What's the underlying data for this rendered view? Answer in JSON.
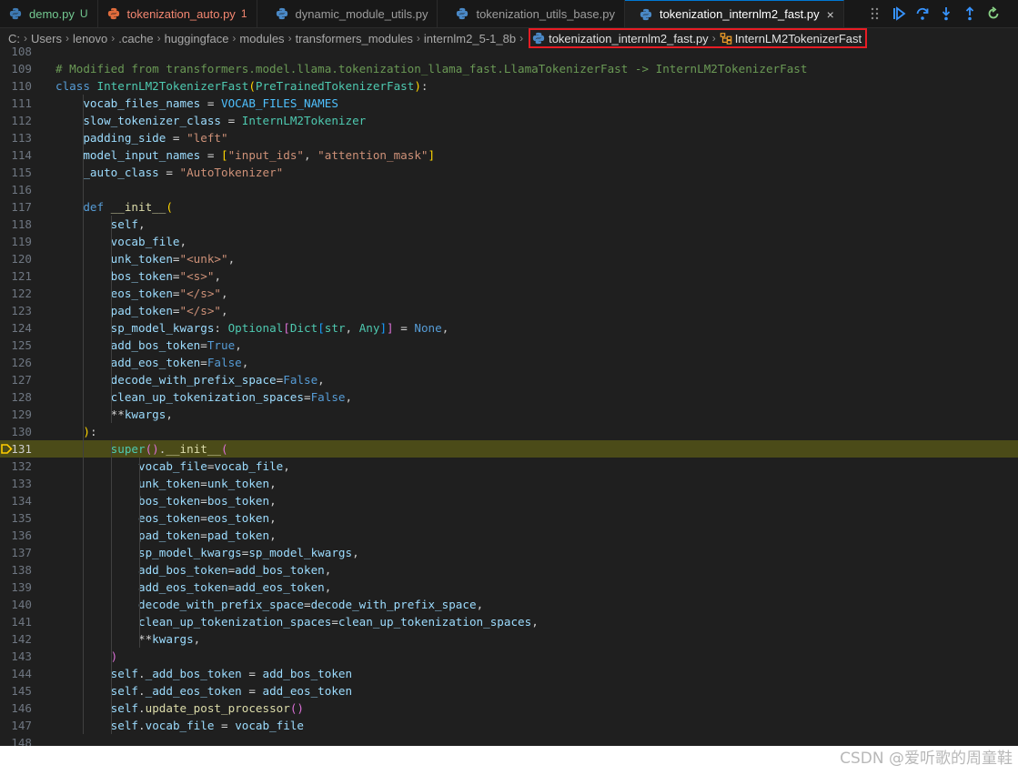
{
  "tabs": [
    {
      "label": "demo.py",
      "badge": "U",
      "state": "modified"
    },
    {
      "label": "tokenization_auto.py",
      "badge": "1",
      "state": "error"
    },
    {
      "label": "dynamic_module_utils.py",
      "badge": "",
      "state": "normal"
    },
    {
      "label": "tokenization_utils_base.py",
      "badge": "",
      "state": "normal"
    },
    {
      "label": "tokenization_internlm2_fast.py",
      "badge": "",
      "state": "active"
    }
  ],
  "tab_close_glyph": "×",
  "debug_toolbar": [
    {
      "name": "drag-handle-icon"
    },
    {
      "name": "continue-icon"
    },
    {
      "name": "step-over-icon"
    },
    {
      "name": "step-into-icon"
    },
    {
      "name": "step-out-icon"
    },
    {
      "name": "restart-icon"
    }
  ],
  "breadcrumb": {
    "path": [
      "C:",
      "Users",
      "lenovo",
      ".cache",
      "huggingface",
      "modules",
      "transformers_modules",
      "internlm2_5-1_8b"
    ],
    "file": "tokenization_internlm2_fast.py",
    "symbol": "InternLM2TokenizerFast",
    "separator": "›"
  },
  "colors": {
    "editor_bg": "#1f1f1f",
    "current_line": "#4b4b18",
    "highlight_box": "#e81c24",
    "comment": "#6a9955",
    "keyword": "#569cd6",
    "class": "#4ec9b0",
    "variable": "#9cdcfe",
    "string": "#ce9178"
  },
  "current_line": 131,
  "code_lines": [
    {
      "n": 108,
      "tokens": []
    },
    {
      "n": 109,
      "tokens": [
        [
          "com",
          "# Modified from transformers.model.llama.tokenization_llama_fast.LlamaTokenizerFast -> InternLM2TokenizerFast"
        ]
      ]
    },
    {
      "n": 110,
      "tokens": [
        [
          "kw",
          "class"
        ],
        [
          "def",
          " "
        ],
        [
          "cls",
          "InternLM2TokenizerFast"
        ],
        [
          "p1",
          "("
        ],
        [
          "cls",
          "PreTrainedTokenizerFast"
        ],
        [
          "p1",
          ")"
        ],
        [
          "def",
          ":"
        ]
      ]
    },
    {
      "n": 111,
      "tokens": [
        [
          "def",
          "    "
        ],
        [
          "var",
          "vocab_files_names"
        ],
        [
          "op",
          " = "
        ],
        [
          "con",
          "VOCAB_FILES_NAMES"
        ]
      ]
    },
    {
      "n": 112,
      "tokens": [
        [
          "def",
          "    "
        ],
        [
          "var",
          "slow_tokenizer_class"
        ],
        [
          "op",
          " = "
        ],
        [
          "cls",
          "InternLM2Tokenizer"
        ]
      ]
    },
    {
      "n": 113,
      "tokens": [
        [
          "def",
          "    "
        ],
        [
          "var",
          "padding_side"
        ],
        [
          "op",
          " = "
        ],
        [
          "str",
          "\"left\""
        ]
      ]
    },
    {
      "n": 114,
      "tokens": [
        [
          "def",
          "    "
        ],
        [
          "var",
          "model_input_names"
        ],
        [
          "op",
          " = "
        ],
        [
          "p1",
          "["
        ],
        [
          "str",
          "\"input_ids\""
        ],
        [
          "def",
          ", "
        ],
        [
          "str",
          "\"attention_mask\""
        ],
        [
          "p1",
          "]"
        ]
      ]
    },
    {
      "n": 115,
      "tokens": [
        [
          "def",
          "    "
        ],
        [
          "var",
          "_auto_class"
        ],
        [
          "op",
          " = "
        ],
        [
          "str",
          "\"AutoTokenizer\""
        ]
      ]
    },
    {
      "n": 116,
      "tokens": []
    },
    {
      "n": 117,
      "tokens": [
        [
          "def",
          "    "
        ],
        [
          "kw",
          "def"
        ],
        [
          "def",
          " "
        ],
        [
          "fn",
          "__init__"
        ],
        [
          "p1",
          "("
        ]
      ]
    },
    {
      "n": 118,
      "tokens": [
        [
          "def",
          "        "
        ],
        [
          "var",
          "self"
        ],
        [
          "def",
          ","
        ]
      ]
    },
    {
      "n": 119,
      "tokens": [
        [
          "def",
          "        "
        ],
        [
          "var",
          "vocab_file"
        ],
        [
          "def",
          ","
        ]
      ]
    },
    {
      "n": 120,
      "tokens": [
        [
          "def",
          "        "
        ],
        [
          "var",
          "unk_token"
        ],
        [
          "op",
          "="
        ],
        [
          "str",
          "\"<unk>\""
        ],
        [
          "def",
          ","
        ]
      ]
    },
    {
      "n": 121,
      "tokens": [
        [
          "def",
          "        "
        ],
        [
          "var",
          "bos_token"
        ],
        [
          "op",
          "="
        ],
        [
          "str",
          "\"<s>\""
        ],
        [
          "def",
          ","
        ]
      ]
    },
    {
      "n": 122,
      "tokens": [
        [
          "def",
          "        "
        ],
        [
          "var",
          "eos_token"
        ],
        [
          "op",
          "="
        ],
        [
          "str",
          "\"</s>\""
        ],
        [
          "def",
          ","
        ]
      ]
    },
    {
      "n": 123,
      "tokens": [
        [
          "def",
          "        "
        ],
        [
          "var",
          "pad_token"
        ],
        [
          "op",
          "="
        ],
        [
          "str",
          "\"</s>\""
        ],
        [
          "def",
          ","
        ]
      ]
    },
    {
      "n": 124,
      "tokens": [
        [
          "def",
          "        "
        ],
        [
          "var",
          "sp_model_kwargs"
        ],
        [
          "def",
          ": "
        ],
        [
          "cls",
          "Optional"
        ],
        [
          "p2",
          "["
        ],
        [
          "cls",
          "Dict"
        ],
        [
          "p3",
          "["
        ],
        [
          "cls",
          "str"
        ],
        [
          "def",
          ", "
        ],
        [
          "cls",
          "Any"
        ],
        [
          "p3",
          "]"
        ],
        [
          "p2",
          "]"
        ],
        [
          "op",
          " = "
        ],
        [
          "kw",
          "None"
        ],
        [
          "def",
          ","
        ]
      ]
    },
    {
      "n": 125,
      "tokens": [
        [
          "def",
          "        "
        ],
        [
          "var",
          "add_bos_token"
        ],
        [
          "op",
          "="
        ],
        [
          "kw",
          "True"
        ],
        [
          "def",
          ","
        ]
      ]
    },
    {
      "n": 126,
      "tokens": [
        [
          "def",
          "        "
        ],
        [
          "var",
          "add_eos_token"
        ],
        [
          "op",
          "="
        ],
        [
          "kw",
          "False"
        ],
        [
          "def",
          ","
        ]
      ]
    },
    {
      "n": 127,
      "tokens": [
        [
          "def",
          "        "
        ],
        [
          "var",
          "decode_with_prefix_space"
        ],
        [
          "op",
          "="
        ],
        [
          "kw",
          "False"
        ],
        [
          "def",
          ","
        ]
      ]
    },
    {
      "n": 128,
      "tokens": [
        [
          "def",
          "        "
        ],
        [
          "var",
          "clean_up_tokenization_spaces"
        ],
        [
          "op",
          "="
        ],
        [
          "kw",
          "False"
        ],
        [
          "def",
          ","
        ]
      ]
    },
    {
      "n": 129,
      "tokens": [
        [
          "def",
          "        "
        ],
        [
          "op",
          "**"
        ],
        [
          "var",
          "kwargs"
        ],
        [
          "def",
          ","
        ]
      ]
    },
    {
      "n": 130,
      "tokens": [
        [
          "def",
          "    "
        ],
        [
          "p1",
          ")"
        ],
        [
          "def",
          ":"
        ]
      ]
    },
    {
      "n": 131,
      "tokens": [
        [
          "def",
          "        "
        ],
        [
          "cls",
          "super"
        ],
        [
          "p2",
          "()"
        ],
        [
          "def",
          "."
        ],
        [
          "fn",
          "__init__"
        ],
        [
          "p2",
          "("
        ]
      ]
    },
    {
      "n": 132,
      "tokens": [
        [
          "def",
          "            "
        ],
        [
          "var",
          "vocab_file"
        ],
        [
          "op",
          "="
        ],
        [
          "var",
          "vocab_file"
        ],
        [
          "def",
          ","
        ]
      ]
    },
    {
      "n": 133,
      "tokens": [
        [
          "def",
          "            "
        ],
        [
          "var",
          "unk_token"
        ],
        [
          "op",
          "="
        ],
        [
          "var",
          "unk_token"
        ],
        [
          "def",
          ","
        ]
      ]
    },
    {
      "n": 134,
      "tokens": [
        [
          "def",
          "            "
        ],
        [
          "var",
          "bos_token"
        ],
        [
          "op",
          "="
        ],
        [
          "var",
          "bos_token"
        ],
        [
          "def",
          ","
        ]
      ]
    },
    {
      "n": 135,
      "tokens": [
        [
          "def",
          "            "
        ],
        [
          "var",
          "eos_token"
        ],
        [
          "op",
          "="
        ],
        [
          "var",
          "eos_token"
        ],
        [
          "def",
          ","
        ]
      ]
    },
    {
      "n": 136,
      "tokens": [
        [
          "def",
          "            "
        ],
        [
          "var",
          "pad_token"
        ],
        [
          "op",
          "="
        ],
        [
          "var",
          "pad_token"
        ],
        [
          "def",
          ","
        ]
      ]
    },
    {
      "n": 137,
      "tokens": [
        [
          "def",
          "            "
        ],
        [
          "var",
          "sp_model_kwargs"
        ],
        [
          "op",
          "="
        ],
        [
          "var",
          "sp_model_kwargs"
        ],
        [
          "def",
          ","
        ]
      ]
    },
    {
      "n": 138,
      "tokens": [
        [
          "def",
          "            "
        ],
        [
          "var",
          "add_bos_token"
        ],
        [
          "op",
          "="
        ],
        [
          "var",
          "add_bos_token"
        ],
        [
          "def",
          ","
        ]
      ]
    },
    {
      "n": 139,
      "tokens": [
        [
          "def",
          "            "
        ],
        [
          "var",
          "add_eos_token"
        ],
        [
          "op",
          "="
        ],
        [
          "var",
          "add_eos_token"
        ],
        [
          "def",
          ","
        ]
      ]
    },
    {
      "n": 140,
      "tokens": [
        [
          "def",
          "            "
        ],
        [
          "var",
          "decode_with_prefix_space"
        ],
        [
          "op",
          "="
        ],
        [
          "var",
          "decode_with_prefix_space"
        ],
        [
          "def",
          ","
        ]
      ]
    },
    {
      "n": 141,
      "tokens": [
        [
          "def",
          "            "
        ],
        [
          "var",
          "clean_up_tokenization_spaces"
        ],
        [
          "op",
          "="
        ],
        [
          "var",
          "clean_up_tokenization_spaces"
        ],
        [
          "def",
          ","
        ]
      ]
    },
    {
      "n": 142,
      "tokens": [
        [
          "def",
          "            "
        ],
        [
          "op",
          "**"
        ],
        [
          "var",
          "kwargs"
        ],
        [
          "def",
          ","
        ]
      ]
    },
    {
      "n": 143,
      "tokens": [
        [
          "def",
          "        "
        ],
        [
          "p2",
          ")"
        ]
      ]
    },
    {
      "n": 144,
      "tokens": [
        [
          "def",
          "        "
        ],
        [
          "var",
          "self"
        ],
        [
          "def",
          "."
        ],
        [
          "var",
          "_add_bos_token"
        ],
        [
          "op",
          " = "
        ],
        [
          "var",
          "add_bos_token"
        ]
      ]
    },
    {
      "n": 145,
      "tokens": [
        [
          "def",
          "        "
        ],
        [
          "var",
          "self"
        ],
        [
          "def",
          "."
        ],
        [
          "var",
          "_add_eos_token"
        ],
        [
          "op",
          " = "
        ],
        [
          "var",
          "add_eos_token"
        ]
      ]
    },
    {
      "n": 146,
      "tokens": [
        [
          "def",
          "        "
        ],
        [
          "var",
          "self"
        ],
        [
          "def",
          "."
        ],
        [
          "fn",
          "update_post_processor"
        ],
        [
          "p2",
          "()"
        ]
      ]
    },
    {
      "n": 147,
      "tokens": [
        [
          "def",
          "        "
        ],
        [
          "var",
          "self"
        ],
        [
          "def",
          "."
        ],
        [
          "var",
          "vocab_file"
        ],
        [
          "op",
          " = "
        ],
        [
          "var",
          "vocab_file"
        ]
      ]
    },
    {
      "n": 148,
      "tokens": []
    }
  ],
  "watermark": "CSDN @爱听歌的周童鞋"
}
